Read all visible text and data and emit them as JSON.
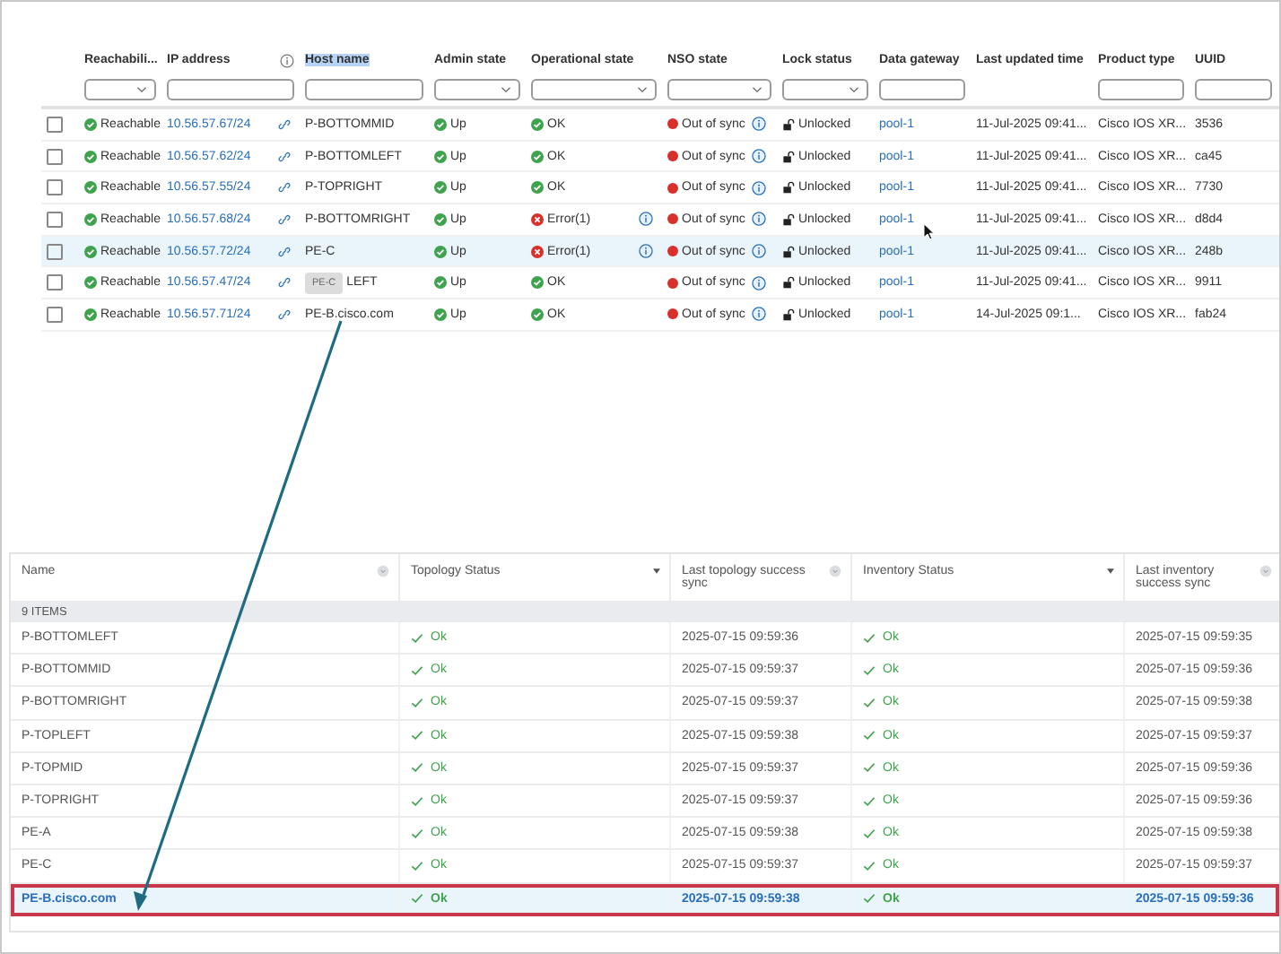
{
  "devices": {
    "columns": [
      {
        "label": "Reachabili...",
        "kind": "select",
        "info": false,
        "highlighted": false
      },
      {
        "label": "IP address",
        "kind": "text",
        "info": true,
        "highlighted": false
      },
      {
        "label": "Host name",
        "kind": "text",
        "info": false,
        "highlighted": true
      },
      {
        "label": "Admin state",
        "kind": "select",
        "info": false,
        "highlighted": false
      },
      {
        "label": "Operational state",
        "kind": "select",
        "info": false,
        "highlighted": false
      },
      {
        "label": "NSO state",
        "kind": "select",
        "info": false,
        "highlighted": false
      },
      {
        "label": "Lock status",
        "kind": "select",
        "info": false,
        "highlighted": false
      },
      {
        "label": "Data gateway",
        "kind": "text",
        "info": false,
        "highlighted": false
      },
      {
        "label": "Last updated time",
        "kind": "none",
        "info": false,
        "highlighted": false
      },
      {
        "label": "Product type",
        "kind": "text",
        "info": false,
        "highlighted": false
      },
      {
        "label": "UUID",
        "kind": "text",
        "info": false,
        "highlighted": false
      }
    ],
    "rows": [
      {
        "checked": false,
        "selected": false,
        "reachability": "Reachable",
        "ip": "10.56.57.67/24",
        "host": "P-BOTTOMMID",
        "admin": "Up",
        "op": {
          "kind": "ok",
          "text": "OK"
        },
        "nso": "Out of sync",
        "lock": "Unlocked",
        "gateway": "pool-1",
        "cursor": false,
        "updated": "11-Jul-2025 09:41...",
        "product": "Cisco IOS XR...",
        "uuid": "3536"
      },
      {
        "checked": false,
        "selected": false,
        "reachability": "Reachable",
        "ip": "10.56.57.62/24",
        "host": "P-BOTTOMLEFT",
        "admin": "Up",
        "op": {
          "kind": "ok",
          "text": "OK"
        },
        "nso": "Out of sync",
        "lock": "Unlocked",
        "gateway": "pool-1",
        "cursor": false,
        "updated": "11-Jul-2025 09:41...",
        "product": "Cisco IOS XR...",
        "uuid": "ca45"
      },
      {
        "checked": false,
        "selected": false,
        "reachability": "Reachable",
        "ip": "10.56.57.55/24",
        "host": "P-TOPRIGHT",
        "admin": "Up",
        "op": {
          "kind": "ok",
          "text": "OK"
        },
        "nso": "Out of sync",
        "lock": "Unlocked",
        "gateway": "pool-1",
        "cursor": false,
        "updated": "11-Jul-2025 09:41...",
        "product": "Cisco IOS XR...",
        "uuid": "7730"
      },
      {
        "checked": false,
        "selected": false,
        "reachability": "Reachable",
        "ip": "10.56.57.68/24",
        "host": "P-BOTTOMRIGHT",
        "admin": "Up",
        "op": {
          "kind": "error",
          "text": "Error(1)"
        },
        "nso": "Out of sync",
        "lock": "Unlocked",
        "gateway": "pool-1",
        "cursor": true,
        "updated": "11-Jul-2025 09:41...",
        "product": "Cisco IOS XR...",
        "uuid": "d8d4"
      },
      {
        "checked": false,
        "selected": true,
        "reachability": "Reachable",
        "ip": "10.56.57.72/24",
        "host": "PE-C",
        "admin": "Up",
        "op": {
          "kind": "error",
          "text": "Error(1)"
        },
        "nso": "Out of sync",
        "lock": "Unlocked",
        "gateway": "pool-1",
        "cursor": false,
        "updated": "11-Jul-2025 09:41...",
        "product": "Cisco IOS XR...",
        "uuid": "248b"
      },
      {
        "checked": false,
        "selected": false,
        "reachability": "Reachable",
        "ip": "10.56.57.47/24",
        "tooltip": "PE-C",
        "host": "LEFT",
        "admin": "Up",
        "op": {
          "kind": "ok",
          "text": "OK"
        },
        "nso": "Out of sync",
        "lock": "Unlocked",
        "gateway": "pool-1",
        "cursor": false,
        "updated": "11-Jul-2025 09:41...",
        "product": "Cisco IOS XR...",
        "uuid": "9911"
      },
      {
        "checked": false,
        "selected": false,
        "reachability": "Reachable",
        "ip": "10.56.57.71/24",
        "host": "PE-B.cisco.com",
        "admin": "Up",
        "op": {
          "kind": "ok",
          "text": "OK"
        },
        "nso": "Out of sync",
        "lock": "Unlocked",
        "gateway": "pool-1",
        "cursor": false,
        "updated": "14-Jul-2025 09:1...",
        "product": "Cisco IOS XR...",
        "uuid": "fab24"
      }
    ]
  },
  "inventory": {
    "columns": [
      {
        "label": "Name",
        "kind": "menu"
      },
      {
        "label": "Topology Status",
        "kind": "caret"
      },
      {
        "label": "Last topology success sync",
        "kind": "menu"
      },
      {
        "label": "Inventory Status",
        "kind": "caret"
      },
      {
        "label": "Last inventory success sync",
        "kind": "menu"
      }
    ],
    "count": "9 ITEMS",
    "rows": [
      {
        "selected": false,
        "name": "P-BOTTOMLEFT",
        "topology": "Ok",
        "last_topology": "2025-07-15 09:59:36",
        "inventory": "Ok",
        "last_inventory": "2025-07-15 09:59:35"
      },
      {
        "selected": false,
        "name": "P-BOTTOMMID",
        "topology": "Ok",
        "last_topology": "2025-07-15 09:59:37",
        "inventory": "Ok",
        "last_inventory": "2025-07-15 09:59:36"
      },
      {
        "selected": false,
        "name": "P-BOTTOMRIGHT",
        "topology": "Ok",
        "last_topology": "2025-07-15 09:59:37",
        "inventory": "Ok",
        "last_inventory": "2025-07-15 09:59:38"
      },
      {
        "selected": false,
        "name": "P-TOPLEFT",
        "topology": "Ok",
        "last_topology": "2025-07-15 09:59:38",
        "inventory": "Ok",
        "last_inventory": "2025-07-15 09:59:37"
      },
      {
        "selected": false,
        "name": "P-TOPMID",
        "topology": "Ok",
        "last_topology": "2025-07-15 09:59:37",
        "inventory": "Ok",
        "last_inventory": "2025-07-15 09:59:36"
      },
      {
        "selected": false,
        "name": "P-TOPRIGHT",
        "topology": "Ok",
        "last_topology": "2025-07-15 09:59:37",
        "inventory": "Ok",
        "last_inventory": "2025-07-15 09:59:36"
      },
      {
        "selected": false,
        "name": "PE-A",
        "topology": "Ok",
        "last_topology": "2025-07-15 09:59:38",
        "inventory": "Ok",
        "last_inventory": "2025-07-15 09:59:38"
      },
      {
        "selected": false,
        "name": "PE-C",
        "topology": "Ok",
        "last_topology": "2025-07-15 09:59:37",
        "inventory": "Ok",
        "last_inventory": "2025-07-15 09:59:37"
      },
      {
        "selected": true,
        "name": "PE-B.cisco.com",
        "topology": "Ok",
        "last_topology": "2025-07-15 09:59:38",
        "inventory": "Ok",
        "last_inventory": "2025-07-15 09:59:36"
      }
    ]
  },
  "callout": {
    "kind": "arrow"
  }
}
